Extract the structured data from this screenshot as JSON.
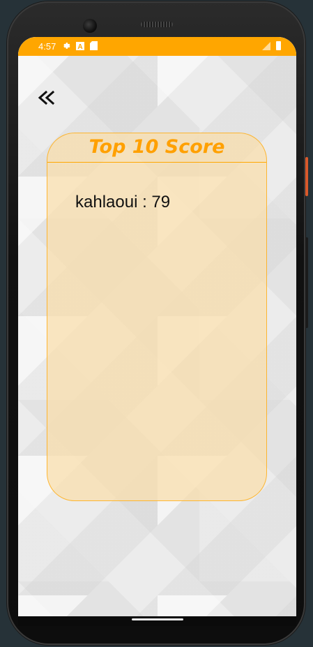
{
  "status_bar": {
    "time": "4:57",
    "icons": [
      "settings-icon",
      "a-icon",
      "sd-card-icon"
    ],
    "right_icons": [
      "signal-icon",
      "battery-icon"
    ],
    "color": "#ffa600"
  },
  "back_button": {
    "icon": "double-chevron-left-icon"
  },
  "score_card": {
    "title": "Top 10 Score",
    "entries": [
      {
        "text": "kahlaoui : 79"
      }
    ],
    "accent_color": "#ffa000"
  }
}
